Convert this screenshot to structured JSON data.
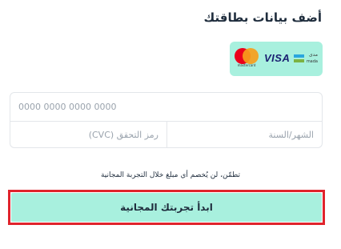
{
  "heading": "أضف بيانات بطاقتك",
  "card_brands": {
    "mada_ar": "مدى",
    "mada_en": "mada",
    "visa": "VISA",
    "mastercard": "mastercard",
    "icons": [
      "mada-icon",
      "visa-icon",
      "mastercard-icon"
    ],
    "badge_color": "#a8f0de"
  },
  "form": {
    "card_number_placeholder": "0000 0000 0000 0000",
    "expiry_placeholder": "الشهر/السنة",
    "cvc_placeholder": "رمز التحقق (CVC)"
  },
  "note": "تطمّن، لن يُخصم أي مبلغ خلال التجربة المجانية",
  "cta": {
    "label": "ابدأ تجربتك المجانية",
    "color": "#a8f0de",
    "highlight_color": "#e0242c"
  }
}
